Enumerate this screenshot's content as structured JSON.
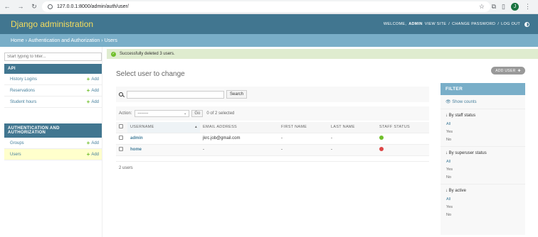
{
  "browser": {
    "url": "127.0.0.1:8000/admin/auth/user/",
    "profile_initial": "J"
  },
  "header": {
    "brand": "Django administration",
    "welcome": "WELCOME,",
    "username": "ADMIN",
    "view_site": "VIEW SITE",
    "change_password": "CHANGE PASSWORD",
    "log_out": "LOG OUT"
  },
  "breadcrumbs": [
    "Home",
    "Authentication and Authorization",
    "Users"
  ],
  "sidebar": {
    "filter_placeholder": "Start typing to filter...",
    "modules": [
      {
        "caption": "API",
        "rows": [
          {
            "label": "History Logins",
            "add": "Add"
          },
          {
            "label": "Reservations",
            "add": "Add"
          },
          {
            "label": "Student hours",
            "add": "Add"
          }
        ]
      },
      {
        "caption": "AUTHENTICATION AND AUTHORIZATION",
        "rows": [
          {
            "label": "Groups",
            "add": "Add"
          },
          {
            "label": "Users",
            "add": "Add"
          }
        ]
      }
    ]
  },
  "message": "Successfully deleted 3 users.",
  "main": {
    "title": "Select user to change",
    "add_user": "ADD USER",
    "search_button": "Search",
    "action_label": "Action:",
    "action_selected": "---------",
    "go_button": "Go",
    "selection_count": "0 of 2 selected",
    "columns": [
      "USERNAME",
      "EMAIL ADDRESS",
      "FIRST NAME",
      "LAST NAME",
      "STAFF STATUS"
    ],
    "rows": [
      {
        "username": "admin",
        "email": "jkrc.job@gmail.com",
        "first": "-",
        "last": "-",
        "staff": true
      },
      {
        "username": "home",
        "email": "-",
        "first": "-",
        "last": "-",
        "staff": false
      }
    ],
    "paginator": "2 users"
  },
  "filter": {
    "caption": "FILTER",
    "show_counts": "Show counts",
    "groups": [
      {
        "title": "↓ By staff status",
        "options": [
          "All",
          "Yes",
          "No"
        ]
      },
      {
        "title": "↓ By superuser status",
        "options": [
          "All",
          "Yes",
          "No"
        ]
      },
      {
        "title": "↓ By active",
        "options": [
          "All",
          "Yes",
          "No"
        ]
      }
    ]
  }
}
